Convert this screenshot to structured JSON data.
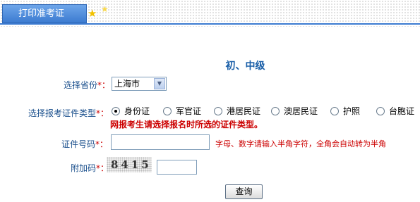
{
  "tab": {
    "label": "打印准考证"
  },
  "level_title": "初、中级",
  "form": {
    "province_label": "选择省份",
    "province_value": "上海市",
    "id_type_label": "选择报考证件类型",
    "id_types": [
      {
        "label": "身份证",
        "checked": true
      },
      {
        "label": "军官证",
        "checked": false
      },
      {
        "label": "港居民证",
        "checked": false
      },
      {
        "label": "澳居民证",
        "checked": false
      },
      {
        "label": "护照",
        "checked": false
      },
      {
        "label": "台胞证",
        "checked": false
      }
    ],
    "id_type_notice": "网报考生请选择报名时所选的证件类型。",
    "id_number_label": "证件号码",
    "id_number_value": "",
    "id_number_hint": "字母、数字请输入半角字符，全角会自动转为半角",
    "captcha_label": "附加码",
    "captcha_text": "8415",
    "captcha_value": "",
    "required_mark": "*：",
    "submit_label": "查询"
  },
  "colors": {
    "accent": "#3c7bd1",
    "label": "#1a4f8c",
    "required": "#cc0000",
    "title": "#1a5fa8"
  }
}
